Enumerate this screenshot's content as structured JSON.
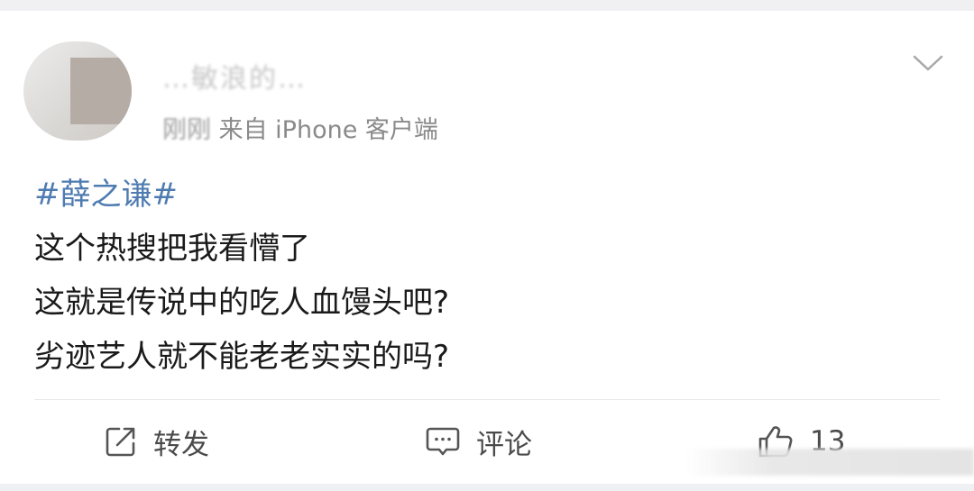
{
  "post": {
    "username": "…敏浪的…",
    "meta_time": "刚刚",
    "meta_source": "来自 iPhone 客户端",
    "hashtag": "#薛之谦#",
    "lines": [
      "这个热搜把我看懵了",
      "这就是传说中的吃人血馒头吧?",
      "劣迹艺人就不能老老实实的吗?"
    ]
  },
  "actions": {
    "repost_label": "转发",
    "comment_label": "评论",
    "like_count": "13"
  },
  "icons": {
    "menu": "chevron-down-icon",
    "repost": "share-icon",
    "comment": "comment-icon",
    "like": "thumbs-up-icon"
  },
  "colors": {
    "hashtag": "#4e7bb0",
    "text": "#1a1a1a",
    "meta": "#8a8a8a"
  }
}
